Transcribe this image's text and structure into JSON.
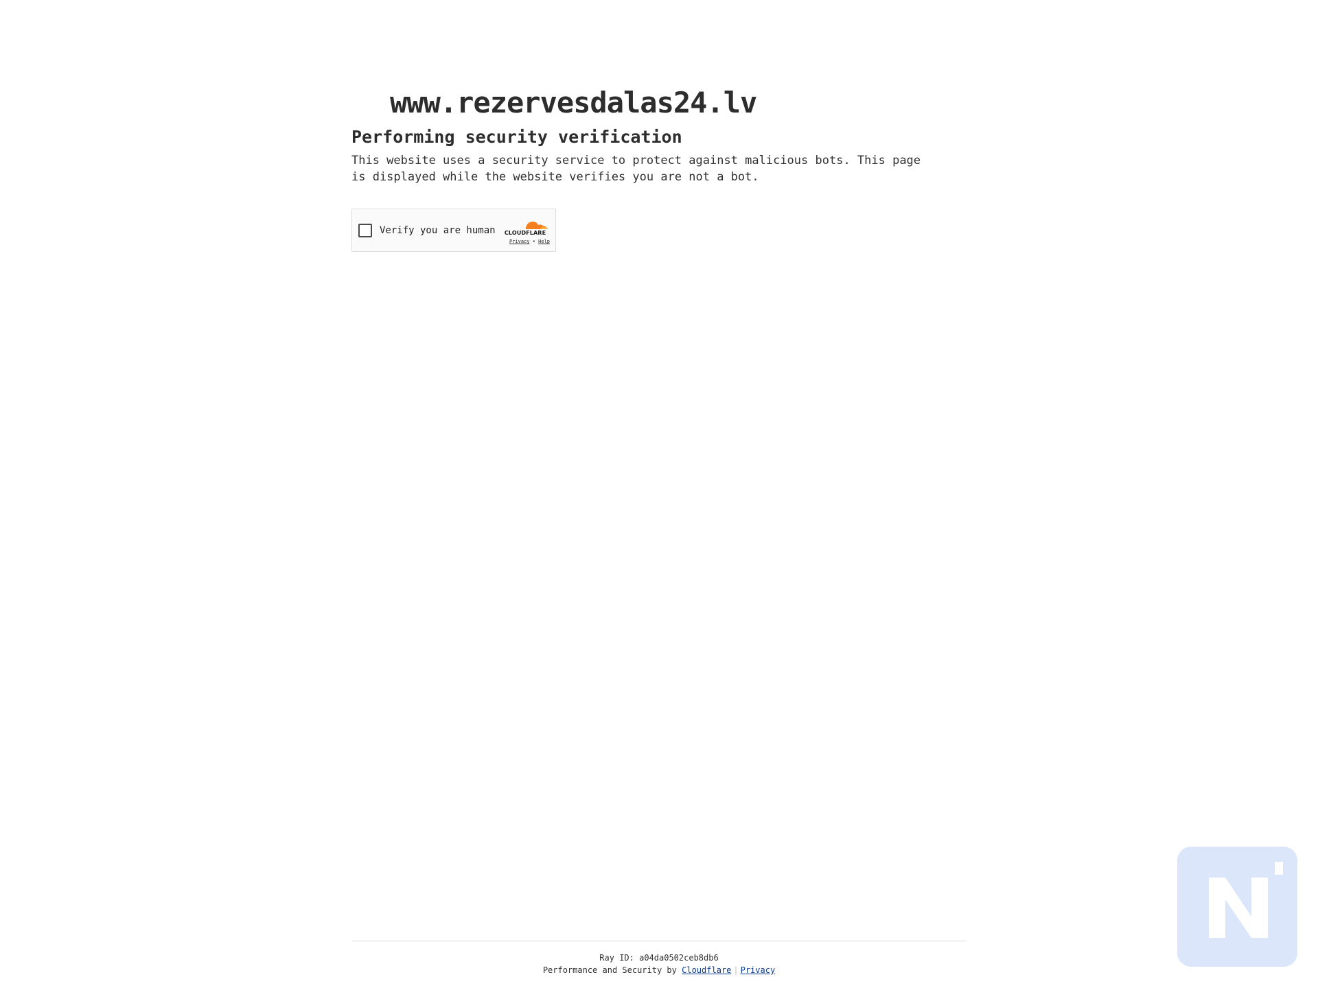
{
  "site": {
    "domain": "www.rezervesdalas24.lv"
  },
  "main": {
    "heading": "Performing security verification",
    "description": "This website uses a security service to protect against malicious bots. This page is displayed while the website verifies you are not a bot."
  },
  "widget": {
    "label": "Verify you are human",
    "brand": "CLOUDFLARE",
    "privacy_label": "Privacy",
    "separator": "•",
    "help_label": "Help"
  },
  "footer": {
    "ray_id": "Ray ID: a04da0502ceb8db6",
    "perf_prefix": "Performance and Security by",
    "cloudflare_link": "Cloudflare",
    "divider": "|",
    "privacy_link": "Privacy"
  },
  "colors": {
    "cloudflare_orange": "#f38020",
    "cloudflare_orange_light": "#faae40",
    "badge_bg": "#dbe6fb"
  },
  "icons": {
    "badge": "n-logo-icon"
  }
}
